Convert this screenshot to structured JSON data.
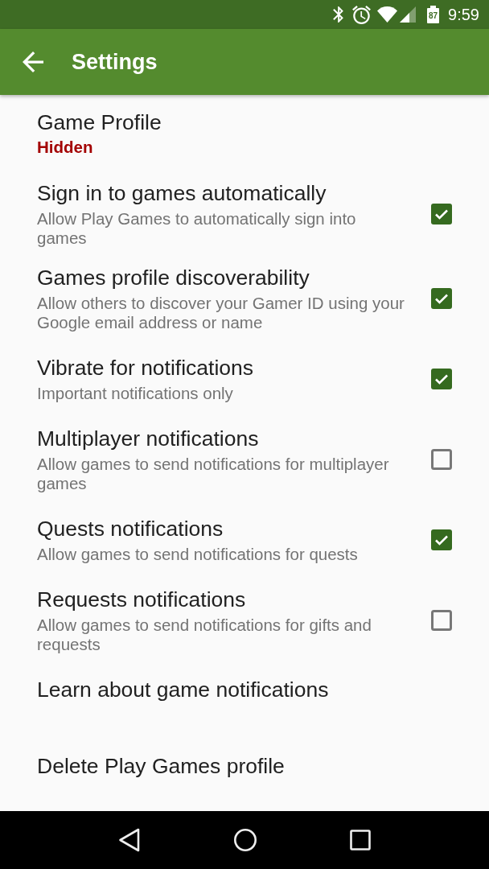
{
  "status_bar": {
    "battery_percent": "87",
    "time": "9:59"
  },
  "app_bar": {
    "title": "Settings"
  },
  "preferences": [
    {
      "kind": "status",
      "title": "Game Profile",
      "summary": "Hidden"
    },
    {
      "kind": "checkbox",
      "title": "Sign in to games automatically",
      "summary": "Allow Play Games to automatically sign into games",
      "checked": true
    },
    {
      "kind": "checkbox",
      "title": "Games profile discoverability",
      "summary": "Allow others to discover your Gamer ID using your Google email address or name",
      "checked": true
    },
    {
      "kind": "checkbox",
      "title": "Vibrate for notifications",
      "summary": "Important notifications only",
      "checked": true
    },
    {
      "kind": "checkbox",
      "title": "Multiplayer notifications",
      "summary": "Allow games to send notifications for multiplayer games",
      "checked": false
    },
    {
      "kind": "checkbox",
      "title": "Quests notifications",
      "summary": "Allow games to send notifications for quests",
      "checked": true
    },
    {
      "kind": "checkbox",
      "title": "Requests notifications",
      "summary": "Allow games to send notifications for gifts and requests",
      "checked": false
    },
    {
      "kind": "link",
      "title": "Learn about game notifications"
    },
    {
      "kind": "link",
      "title": "Delete Play Games profile"
    }
  ]
}
